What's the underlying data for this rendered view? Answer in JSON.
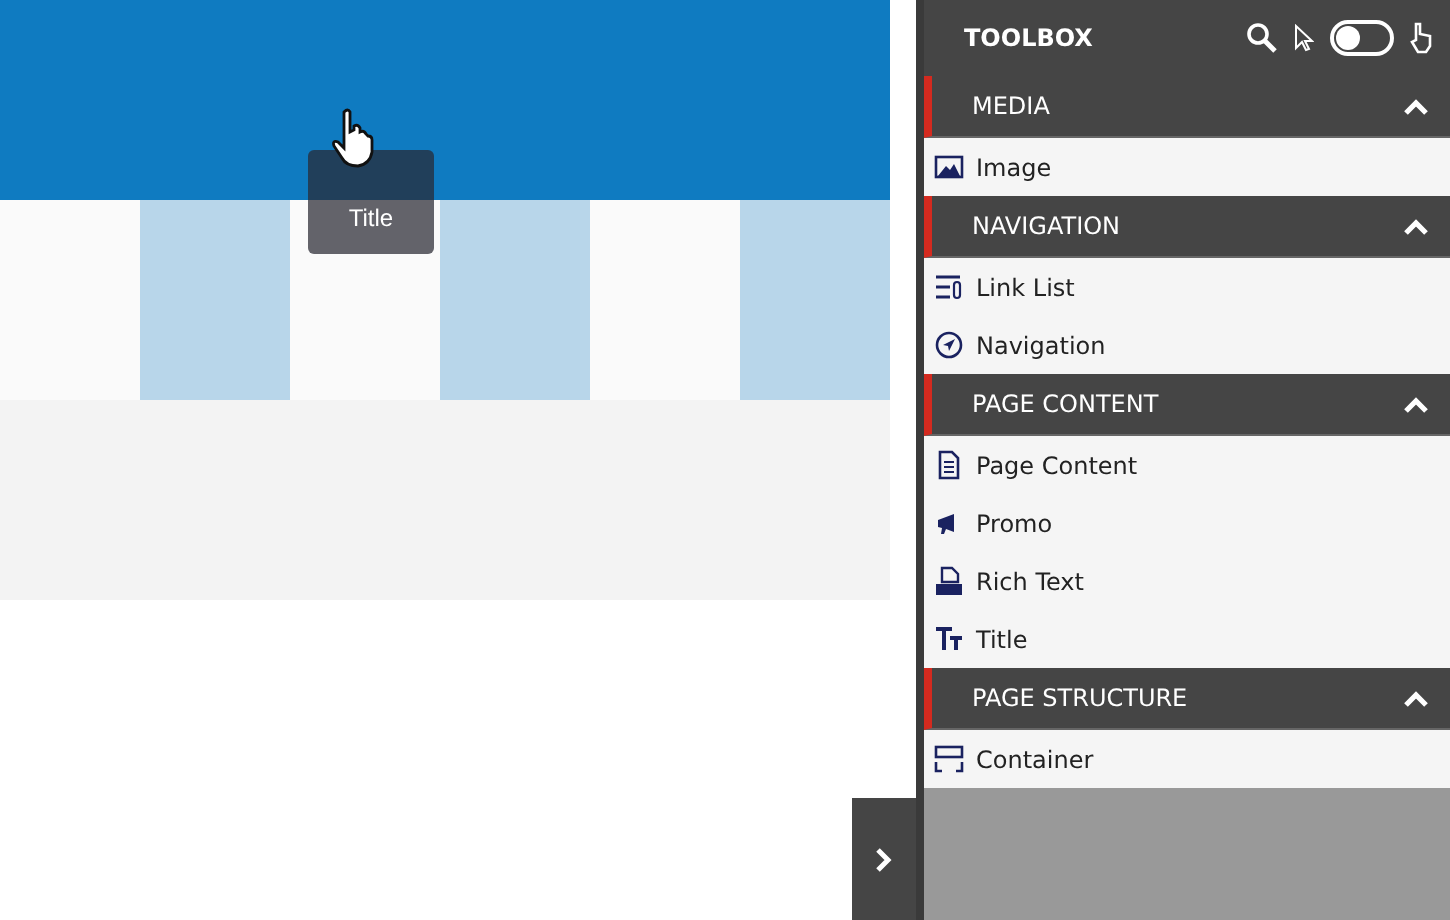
{
  "canvas": {
    "drag_label": "Title"
  },
  "toolbox": {
    "title": "TOOLBOX",
    "mode_toggle_on": false
  },
  "sections": [
    {
      "title": "MEDIA",
      "expanded": true,
      "items": [
        {
          "label": "Image",
          "kind": "image"
        }
      ]
    },
    {
      "title": "NAVIGATION",
      "expanded": true,
      "items": [
        {
          "label": "Link List",
          "kind": "linklist"
        },
        {
          "label": "Navigation",
          "kind": "navigation"
        }
      ]
    },
    {
      "title": "PAGE CONTENT",
      "expanded": true,
      "items": [
        {
          "label": "Page Content",
          "kind": "page"
        },
        {
          "label": "Promo",
          "kind": "promo"
        },
        {
          "label": "Rich Text",
          "kind": "richtext"
        },
        {
          "label": "Title",
          "kind": "title"
        }
      ]
    },
    {
      "title": "PAGE STRUCTURE",
      "expanded": true,
      "items": [
        {
          "label": "Container",
          "kind": "container"
        }
      ]
    }
  ]
}
